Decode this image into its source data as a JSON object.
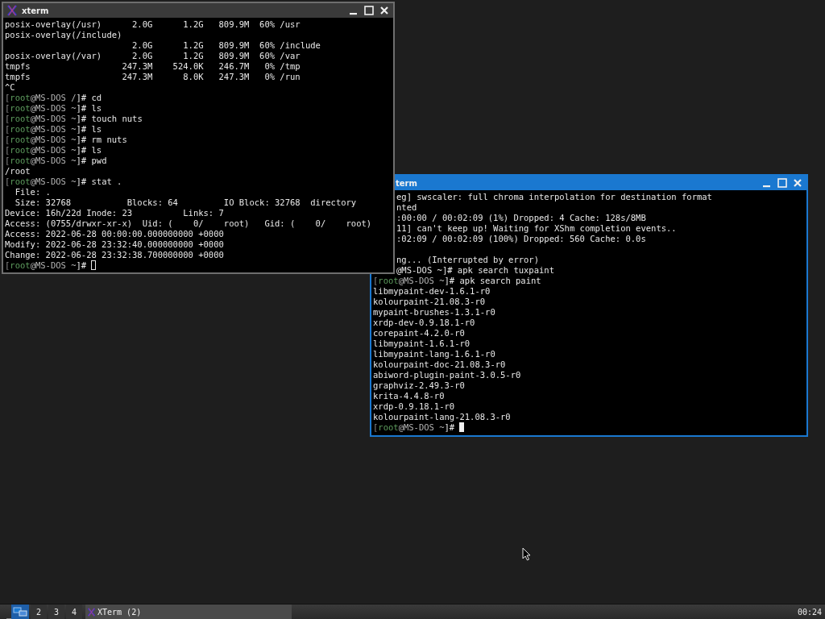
{
  "windows": [
    {
      "title": "xterm",
      "focused": false,
      "covered": false,
      "lines": [
        {
          "text": "posix-overlay(/usr)      2.0G      1.2G   809.9M  60% /usr"
        },
        {
          "text": "posix-overlay(/include)"
        },
        {
          "text": "                         2.0G      1.2G   809.9M  60% /include"
        },
        {
          "text": "posix-overlay(/var)      2.0G      1.2G   809.9M  60% /var"
        },
        {
          "text": "tmpfs                  247.3M    524.0K   246.7M   0% /tmp"
        },
        {
          "text": "tmpfs                  247.3M      8.0K   247.3M   0% /run"
        },
        {
          "text": "^C"
        },
        {
          "segments": [
            {
              "text": "[",
              "kind": "bracket"
            },
            {
              "text": "root",
              "kind": "user"
            },
            {
              "text": "@MS-DOS /",
              "kind": "host"
            },
            {
              "text": "]# cd",
              "kind": "command"
            }
          ]
        },
        {
          "segments": [
            {
              "text": "[",
              "kind": "bracket"
            },
            {
              "text": "root",
              "kind": "user"
            },
            {
              "text": "@MS-DOS ~",
              "kind": "host"
            },
            {
              "text": "]# ls",
              "kind": "command"
            }
          ]
        },
        {
          "segments": [
            {
              "text": "[",
              "kind": "bracket"
            },
            {
              "text": "root",
              "kind": "user"
            },
            {
              "text": "@MS-DOS ~",
              "kind": "host"
            },
            {
              "text": "]# touch nuts",
              "kind": "command"
            }
          ]
        },
        {
          "segments": [
            {
              "text": "[",
              "kind": "bracket"
            },
            {
              "text": "root",
              "kind": "user"
            },
            {
              "text": "@MS-DOS ~",
              "kind": "host"
            },
            {
              "text": "]# ls",
              "kind": "command"
            }
          ]
        },
        {
          "segments": [
            {
              "text": "[",
              "kind": "bracket"
            },
            {
              "text": "root",
              "kind": "user"
            },
            {
              "text": "@MS-DOS ~",
              "kind": "host"
            },
            {
              "text": "]# rm nuts",
              "kind": "command"
            }
          ]
        },
        {
          "segments": [
            {
              "text": "[",
              "kind": "bracket"
            },
            {
              "text": "root",
              "kind": "user"
            },
            {
              "text": "@MS-DOS ~",
              "kind": "host"
            },
            {
              "text": "]# ls",
              "kind": "command"
            }
          ]
        },
        {
          "segments": [
            {
              "text": "[",
              "kind": "bracket"
            },
            {
              "text": "root",
              "kind": "user"
            },
            {
              "text": "@MS-DOS ~",
              "kind": "host"
            },
            {
              "text": "]# pwd",
              "kind": "command"
            }
          ]
        },
        {
          "text": "/root"
        },
        {
          "segments": [
            {
              "text": "[",
              "kind": "bracket"
            },
            {
              "text": "root",
              "kind": "user"
            },
            {
              "text": "@MS-DOS ~",
              "kind": "host"
            },
            {
              "text": "]# stat .",
              "kind": "command"
            }
          ]
        },
        {
          "text": "  File: ."
        },
        {
          "text": "  Size: 32768           Blocks: 64         IO Block: 32768  directory"
        },
        {
          "text": "Device: 16h/22d Inode: 23          Links: 7"
        },
        {
          "text": "Access: (0755/drwxr-xr-x)  Uid: (    0/    root)   Gid: (    0/    root)"
        },
        {
          "text": "Access: 2022-06-28 00:00:00.000000000 +0000"
        },
        {
          "text": "Modify: 2022-06-28 23:32:40.000000000 +0000"
        },
        {
          "text": "Change: 2022-06-28 23:32:38.700000000 +0000"
        },
        {
          "segments": [
            {
              "text": "[",
              "kind": "bracket"
            },
            {
              "text": "root",
              "kind": "user"
            },
            {
              "text": "@MS-DOS ~",
              "kind": "host"
            },
            {
              "text": "]#",
              "kind": "command"
            }
          ],
          "cursor": true
        }
      ]
    },
    {
      "title": "term",
      "focused": true,
      "covered": true,
      "lines": [
        {
          "text": "eg] swscaler: full chroma interpolation for destination format",
          "kind": "warning",
          "cut": true
        },
        {
          "text": "nted",
          "kind": "warning",
          "cut": true
        },
        {
          "text": ":00:00 / 00:02:09 (1%) Dropped: 4 Cache: 128s/8MB",
          "cut": true
        },
        {
          "text": "11] can't keep up! Waiting for XShm completion events..",
          "kind": "warning",
          "cut": true
        },
        {
          "text": ":02:09 / 00:02:09 (100%) Dropped: 560 Cache: 0.0s",
          "cut": true
        },
        {
          "kind": "blank"
        },
        {
          "text": "ng... (Interrupted by error)",
          "cut": true
        },
        {
          "text": "@MS-DOS ~]# apk search tuxpaint",
          "cut": true
        },
        {
          "segments": [
            {
              "text": "[",
              "kind": "bracket"
            },
            {
              "text": "root",
              "kind": "user"
            },
            {
              "text": "@MS-DOS ~",
              "kind": "host"
            },
            {
              "text": "]# apk search paint",
              "kind": "command"
            }
          ]
        },
        {
          "text": "libmypaint-dev-1.6.1-r0"
        },
        {
          "text": "kolourpaint-21.08.3-r0"
        },
        {
          "text": "mypaint-brushes-1.3.1-r0"
        },
        {
          "text": "xrdp-dev-0.9.18.1-r0"
        },
        {
          "text": "corepaint-4.2.0-r0"
        },
        {
          "text": "libmypaint-1.6.1-r0"
        },
        {
          "text": "libmypaint-lang-1.6.1-r0"
        },
        {
          "text": "kolourpaint-doc-21.08.3-r0"
        },
        {
          "text": "abiword-plugin-paint-3.0.5-r0"
        },
        {
          "text": "graphviz-2.49.3-r0"
        },
        {
          "text": "krita-4.4.8-r0"
        },
        {
          "text": "xrdp-0.9.18.1-r0"
        },
        {
          "text": "kolourpaint-lang-21.08.3-r0"
        },
        {
          "segments": [
            {
              "text": "[",
              "kind": "bracket"
            },
            {
              "text": "root",
              "kind": "user"
            },
            {
              "text": "@MS-DOS ~",
              "kind": "host"
            },
            {
              "text": "]#",
              "kind": "command"
            }
          ],
          "cursor": true
        }
      ]
    }
  ],
  "taskbar": {
    "show_desktop": "_",
    "workspaces": [
      {
        "selected": true
      },
      {
        "label": "2",
        "selected": false
      },
      {
        "label": "3",
        "selected": false
      },
      {
        "label": "4",
        "selected": false
      }
    ],
    "tasks": [
      {
        "label": "XTerm (2)"
      }
    ],
    "clock": "00:24"
  }
}
